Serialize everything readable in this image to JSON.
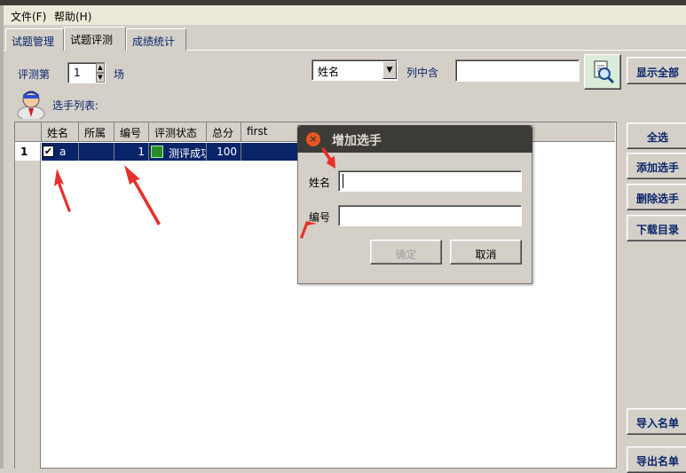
{
  "menu": {
    "file": "文件(F)",
    "help": "帮助(H)"
  },
  "tabs": [
    "试题管理",
    "试题评测",
    "成绩统计"
  ],
  "active_tab": 1,
  "toolbar": {
    "round_prefix": "评测第",
    "round_value": "1",
    "round_suffix": "场",
    "column_select": "姓名",
    "contains_label": "列中含",
    "search_value": "",
    "show_all": "显示全部"
  },
  "players_label": "选手列表:",
  "grid": {
    "columns": [
      "姓名",
      "所属",
      "编号",
      "评测状态",
      "总分",
      "first"
    ],
    "rows": [
      {
        "index": "1",
        "checked": true,
        "name": "a",
        "group": "",
        "number": "1",
        "status": "测评成功",
        "score": "100"
      }
    ]
  },
  "side_buttons": {
    "select_all": "全选",
    "add_player": "添加选手",
    "delete_player": "删除选手",
    "download_dir": "下载目录",
    "import_list": "导入名单",
    "export_list": "导出名单"
  },
  "dialog": {
    "title": "增加选手",
    "name_label": "姓名",
    "number_label": "编号",
    "name_value": "",
    "number_value": "",
    "ok": "确定",
    "cancel": "取消"
  },
  "colors": {
    "selection": "#0a246a",
    "annotation_arrow": "#e8302a",
    "dialog_title_bg": "#3c3b37",
    "close_button": "#e95420"
  }
}
